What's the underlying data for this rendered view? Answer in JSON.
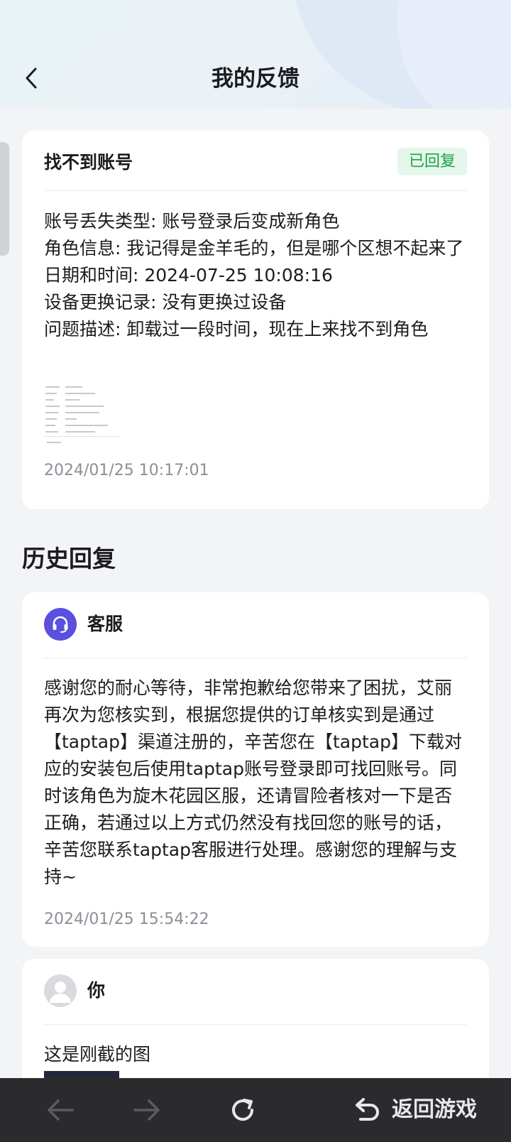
{
  "header": {
    "title": "我的反馈"
  },
  "feedback": {
    "title": "找不到账号",
    "status": "已回复",
    "lines": [
      "账号丢失类型: 账号登录后变成新角色",
      "角色信息: 我记得是金羊毛的，但是哪个区想不起来了",
      "日期和时间: 2024-07-25 10:08:16",
      "设备更换记录: 没有更换过设备",
      "问题描述: 卸载过一段时间，现在上来找不到角色"
    ],
    "timestamp": "2024/01/25 10:17:01"
  },
  "history": {
    "heading": "历史回复",
    "support_reply": {
      "author": "客服",
      "text": "感谢您的耐心等待，非常抱歉给您带来了困扰，艾丽再次为您核实到，根据您提供的订单核实到是通过【taptap】渠道注册的，辛苦您在【taptap】下载对应的安装包后使用taptap账号登录即可找回账号。同时该角色为旋木花园区服，还请冒险者核对一下是否正确，若通过以上方式仍然没有找回您的账号的话，辛苦您联系taptap客服进行处理。感谢您的理解与支持~",
      "timestamp": "2024/01/25 15:54:22"
    },
    "user_reply": {
      "author": "你",
      "text": "这是刚截的图"
    }
  },
  "bottom_bar": {
    "return_label": "返回游戏"
  },
  "colors": {
    "status_green": "#19a34a",
    "support_avatar": "#5b4fdf",
    "bottom_bar": "#2b2b2d"
  }
}
